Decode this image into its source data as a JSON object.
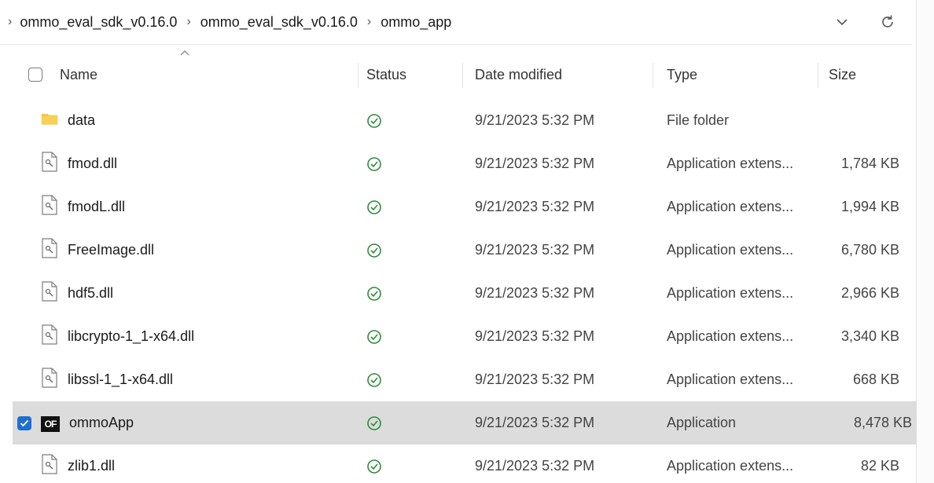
{
  "breadcrumb": {
    "items": [
      "ommo_eval_sdk_v0.16.0",
      "ommo_eval_sdk_v0.16.0",
      "ommo_app"
    ]
  },
  "address_actions": {
    "expand_icon": "chevron-down-icon",
    "refresh_icon": "refresh-icon"
  },
  "columns": {
    "name": "Name",
    "status": "Status",
    "date": "Date modified",
    "type": "Type",
    "size": "Size"
  },
  "colors": {
    "status_green": "#2e8b3a",
    "folder_yellow": "#f2c230",
    "selection": "#dcdcdc",
    "check_blue": "#1f6fd0"
  },
  "files": [
    {
      "name": "data",
      "icon": "folder-icon",
      "date": "9/21/2023 5:32 PM",
      "type": "File folder",
      "size": "",
      "selected": false
    },
    {
      "name": "fmod.dll",
      "icon": "dll-file-icon",
      "date": "9/21/2023 5:32 PM",
      "type": "Application extens...",
      "size": "1,784 KB",
      "selected": false
    },
    {
      "name": "fmodL.dll",
      "icon": "dll-file-icon",
      "date": "9/21/2023 5:32 PM",
      "type": "Application extens...",
      "size": "1,994 KB",
      "selected": false
    },
    {
      "name": "FreeImage.dll",
      "icon": "dll-file-icon",
      "date": "9/21/2023 5:32 PM",
      "type": "Application extens...",
      "size": "6,780 KB",
      "selected": false
    },
    {
      "name": "hdf5.dll",
      "icon": "dll-file-icon",
      "date": "9/21/2023 5:32 PM",
      "type": "Application extens...",
      "size": "2,966 KB",
      "selected": false
    },
    {
      "name": "libcrypto-1_1-x64.dll",
      "icon": "dll-file-icon",
      "date": "9/21/2023 5:32 PM",
      "type": "Application extens...",
      "size": "3,340 KB",
      "selected": false
    },
    {
      "name": "libssl-1_1-x64.dll",
      "icon": "dll-file-icon",
      "date": "9/21/2023 5:32 PM",
      "type": "Application extens...",
      "size": "668 KB",
      "selected": false
    },
    {
      "name": "ommoApp",
      "icon": "of-app-icon",
      "app_icon_text": "OF",
      "date": "9/21/2023 5:32 PM",
      "type": "Application",
      "size": "8,478 KB",
      "selected": true
    },
    {
      "name": "zlib1.dll",
      "icon": "dll-file-icon",
      "date": "9/21/2023 5:32 PM",
      "type": "Application extens...",
      "size": "82 KB",
      "selected": false
    }
  ]
}
